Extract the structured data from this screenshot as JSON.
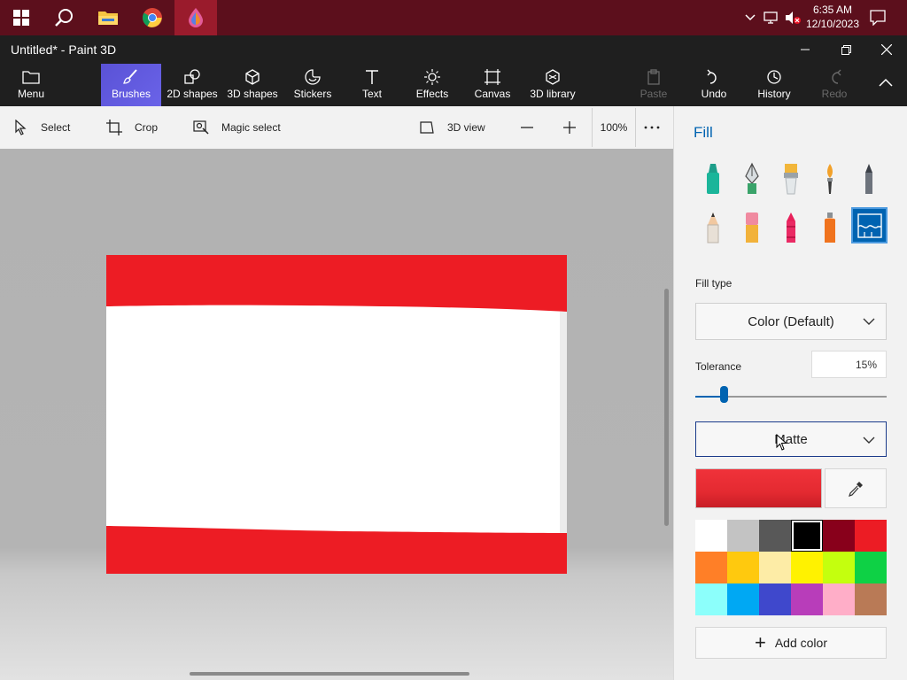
{
  "taskbar": {
    "clock_time": "6:35 AM",
    "clock_date": "12/10/2023"
  },
  "titlebar": {
    "title": "Untitled* - Paint 3D"
  },
  "ribbon": {
    "items": [
      {
        "label": "Menu",
        "icon": "folder-icon"
      },
      {
        "label": "Brushes",
        "icon": "brush-icon",
        "active": true
      },
      {
        "label": "2D shapes",
        "icon": "2d-shapes-icon"
      },
      {
        "label": "3D shapes",
        "icon": "3d-shapes-icon"
      },
      {
        "label": "Stickers",
        "icon": "stickers-icon"
      },
      {
        "label": "Text",
        "icon": "text-icon"
      },
      {
        "label": "Effects",
        "icon": "effects-icon"
      },
      {
        "label": "Canvas",
        "icon": "canvas-icon"
      },
      {
        "label": "3D library",
        "icon": "3d-library-icon"
      },
      {
        "label": "Paste",
        "icon": "paste-icon",
        "disabled": true
      },
      {
        "label": "Undo",
        "icon": "undo-icon"
      },
      {
        "label": "History",
        "icon": "history-icon"
      },
      {
        "label": "Redo",
        "icon": "redo-icon",
        "disabled": true
      }
    ]
  },
  "toolbar": {
    "select": "Select",
    "crop": "Crop",
    "magic_select": "Magic select",
    "view_3d": "3D view",
    "zoom": "100%"
  },
  "panel": {
    "title": "Fill",
    "brushes": [
      "marker",
      "calligraphy-pen",
      "oil-brush",
      "watercolor",
      "pixel-pen",
      "pencil",
      "eraser",
      "crayon",
      "spray-can",
      "fill"
    ],
    "selected_brush": "fill",
    "fill_type_label": "Fill type",
    "fill_type_value": "Color (Default)",
    "tolerance_label": "Tolerance",
    "tolerance_value": "15%",
    "tolerance_level": 0.15,
    "finish_value": "Matte",
    "current_color": "#e8262e",
    "add_color": "Add color",
    "palette": [
      "#ffffff",
      "#c3c3c3",
      "#585858",
      "#000000",
      "#88001b",
      "#ec1c24",
      "#ff7f27",
      "#ffc90e",
      "#fdeca6",
      "#fff200",
      "#c4ff0e",
      "#0ed145",
      "#8cfffb",
      "#00a8f3",
      "#3f48cc",
      "#b83dba",
      "#ffaec8",
      "#b97a56"
    ],
    "selected_swatch": 3
  },
  "canvas": {
    "stripe_color": "#ed1c24",
    "background_color": "#ffffff"
  }
}
